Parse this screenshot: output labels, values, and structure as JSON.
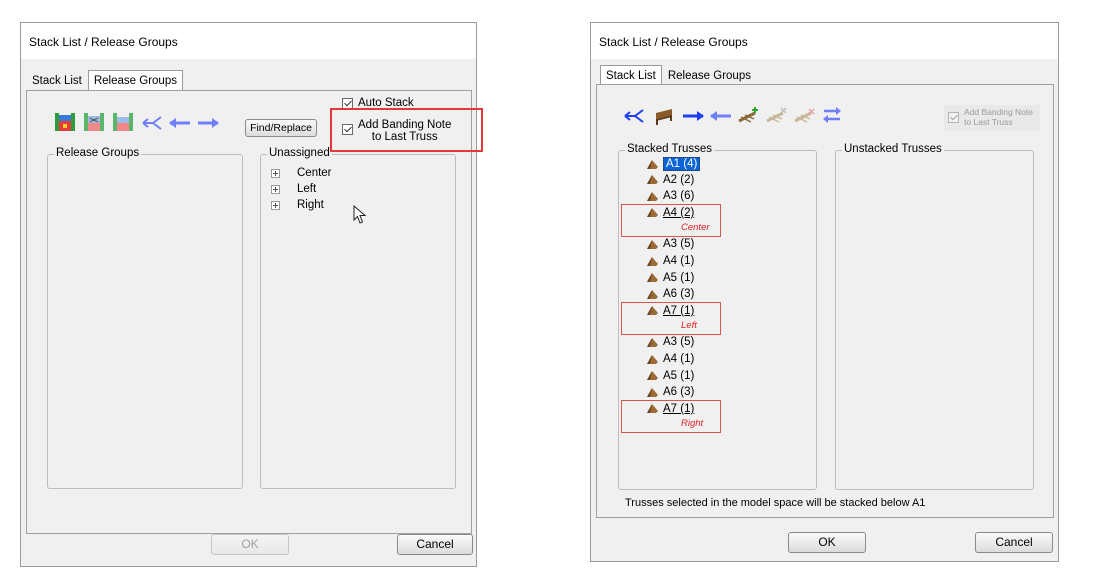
{
  "left_dialog": {
    "title": "Stack List / Release Groups",
    "tabs": [
      {
        "label": "Stack List",
        "active": false
      },
      {
        "label": "Release Groups",
        "active": true
      }
    ],
    "find_replace_label": "Find/Replace",
    "auto_stack": {
      "label": "Auto Stack",
      "checked": true
    },
    "banding_note": {
      "line1": "Add Banding Note",
      "line2": "to Last Truss",
      "checked": true
    },
    "release_groups_label": "Release Groups",
    "unassigned_label": "Unassigned",
    "unassigned_items": [
      "Center",
      "Left",
      "Right"
    ],
    "ok_label": "OK",
    "cancel_label": "Cancel"
  },
  "right_dialog": {
    "title": "Stack List / Release Groups",
    "tabs": [
      {
        "label": "Stack List",
        "active": true
      },
      {
        "label": "Release Groups",
        "active": false
      }
    ],
    "banding_note": {
      "line1": "Add Banding Note",
      "line2": "to Last Truss",
      "checked": true,
      "disabled": true
    },
    "stacked_label": "Stacked Trusses",
    "unstacked_label": "Unstacked Trusses",
    "stacked_items": [
      {
        "label": "A1 (4)",
        "selected": true
      },
      {
        "label": "A2 (2)"
      },
      {
        "label": "A3 (6)"
      },
      {
        "label": "A4 (2)",
        "underline": true,
        "note": "Center"
      },
      {
        "label": "A3 (5)"
      },
      {
        "label": "A4 (1)"
      },
      {
        "label": "A5 (1)"
      },
      {
        "label": "A6 (3)"
      },
      {
        "label": "A7 (1)",
        "underline": true,
        "note": "Left"
      },
      {
        "label": "A3 (5)"
      },
      {
        "label": "A4 (1)"
      },
      {
        "label": "A5 (1)"
      },
      {
        "label": "A6 (3)"
      },
      {
        "label": "A7 (1)",
        "underline": true,
        "note": "Right"
      }
    ],
    "status_text": "Trusses selected in the model space will be stacked  below A1",
    "ok_label": "OK",
    "cancel_label": "Cancel"
  },
  "colors": {
    "highlight_red": "#e23a3a",
    "selection_blue": "#0a64d8",
    "arrow_blue": "#1e3cf0",
    "arrow_light": "#6f7ff5"
  }
}
